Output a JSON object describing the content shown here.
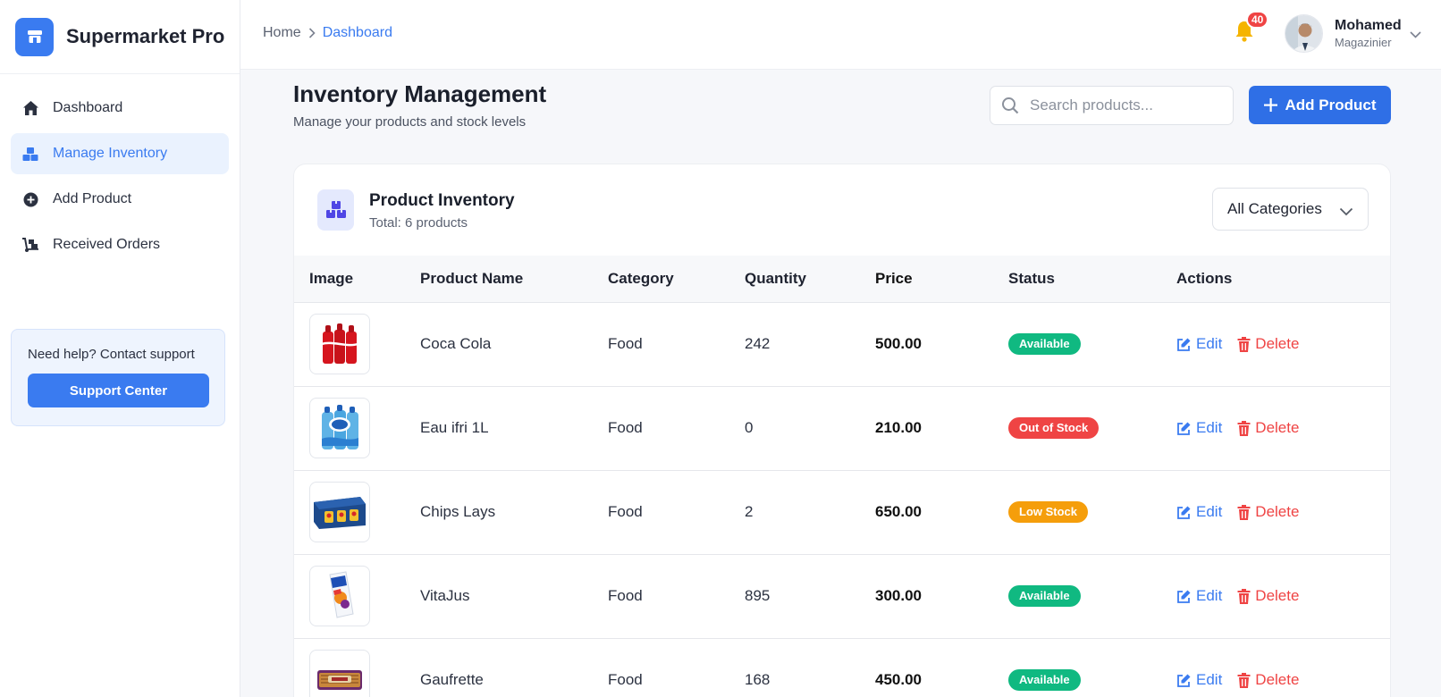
{
  "app": {
    "name": "Supermarket Pro"
  },
  "sidebar": {
    "items": [
      {
        "label": "Dashboard",
        "icon": "home-icon",
        "active": false
      },
      {
        "label": "Manage Inventory",
        "icon": "boxes-icon",
        "active": true
      },
      {
        "label": "Add Product",
        "icon": "plus-circle-icon",
        "active": false
      },
      {
        "label": "Received Orders",
        "icon": "dolly-icon",
        "active": false
      }
    ],
    "help": {
      "text": "Need help? Contact support",
      "button": "Support Center"
    }
  },
  "header": {
    "breadcrumb": {
      "home": "Home",
      "current": "Dashboard"
    },
    "notifications": "40",
    "user": {
      "name": "Mohamed",
      "role": "Magazinier"
    }
  },
  "page": {
    "title": "Inventory Management",
    "subtitle": "Manage your products and stock levels",
    "search_placeholder": "Search products...",
    "add_button": "Add Product"
  },
  "inventory": {
    "title": "Product Inventory",
    "total": "Total: 6 products",
    "category_filter": "All Categories",
    "columns": [
      "Image",
      "Product Name",
      "Category",
      "Quantity",
      "Price",
      "Status",
      "Actions"
    ],
    "rows": [
      {
        "name": "Coca Cola",
        "category": "Food",
        "quantity": "242",
        "price": "500.00",
        "status": "Available",
        "thumb": "cola"
      },
      {
        "name": "Eau ifri 1L",
        "category": "Food",
        "quantity": "0",
        "price": "210.00",
        "status": "Out of Stock",
        "thumb": "water"
      },
      {
        "name": "Chips Lays",
        "category": "Food",
        "quantity": "2",
        "price": "650.00",
        "status": "Low Stock",
        "thumb": "chips"
      },
      {
        "name": "VitaJus",
        "category": "Food",
        "quantity": "895",
        "price": "300.00",
        "status": "Available",
        "thumb": "juice"
      },
      {
        "name": "Gaufrette",
        "category": "Food",
        "quantity": "168",
        "price": "450.00",
        "status": "Available",
        "thumb": "wafer"
      }
    ],
    "edit_label": "Edit",
    "delete_label": "Delete"
  },
  "colors": {
    "accent": "#3a7bf0",
    "available": "#10b981",
    "out_of_stock": "#ef4444",
    "low_stock": "#f59e0b"
  }
}
